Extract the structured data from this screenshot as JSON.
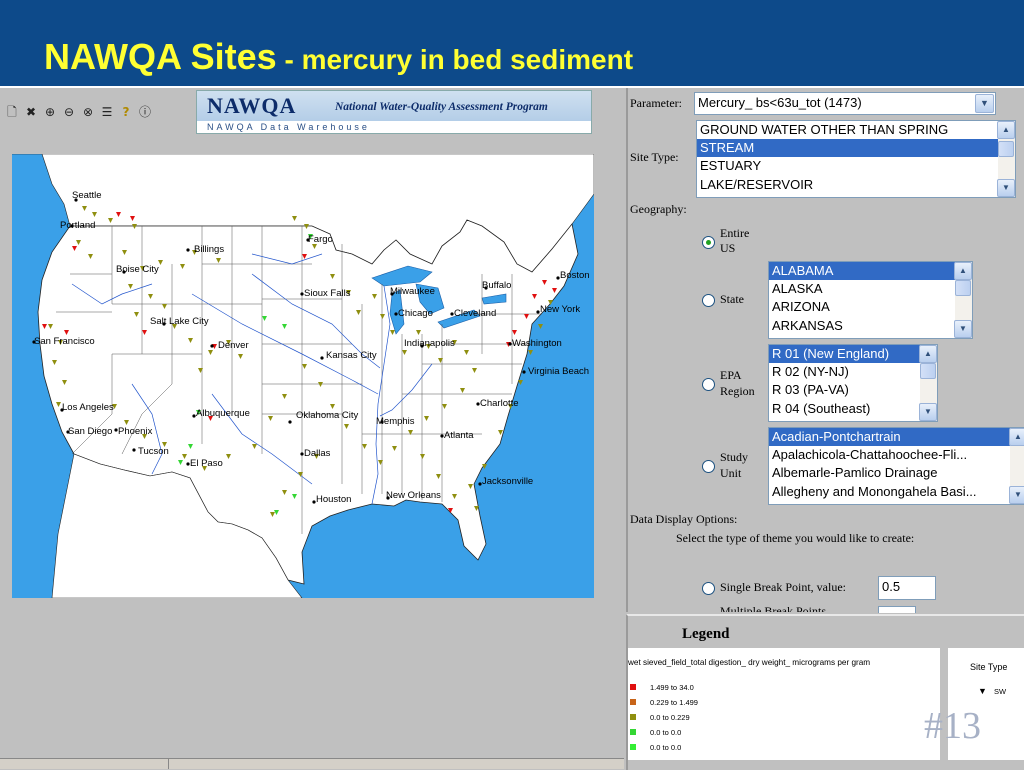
{
  "title": {
    "main": "NAWQA Sites",
    "sub": " - mercury in bed sediment"
  },
  "toolbar_icons": [
    "new-document-icon",
    "pan-icon",
    "zoom-in-icon",
    "zoom-out-icon",
    "zoom-full-icon",
    "layers-icon",
    "help-icon",
    "identify-icon"
  ],
  "banner": {
    "logo": "NAWQA",
    "tagline": "National Water-Quality Assessment Program",
    "subtitle": "NAWQA Data Warehouse"
  },
  "map": {
    "cities": [
      "Seattle",
      "Portland",
      "Billings",
      "Fargo",
      "Boise City",
      "Salt Lake City",
      "Sioux Falls",
      "Milwaukee",
      "Chicago",
      "Cleveland",
      "Buffalo",
      "Boston",
      "New York",
      "Washington",
      "Virginia Beach",
      "San Francisco",
      "Denver",
      "Indianapolis",
      "Kansas City",
      "Los Angeles",
      "San Diego",
      "Phoenix",
      "Tucson",
      "Albuquerque",
      "Oklahoma City",
      "Memphis",
      "Atlanta",
      "Charlotte",
      "El Paso",
      "Dallas",
      "Houston",
      "New Orleans",
      "Jacksonville"
    ]
  },
  "controls": {
    "parameter_label": "Parameter:",
    "parameter_value": "Mercury_ bs<63u_tot (1473)",
    "site_type_label": "Site Type:",
    "site_type_options": [
      "GROUND WATER OTHER THAN SPRING",
      "STREAM",
      "ESTUARY",
      "LAKE/RESERVOIR"
    ],
    "site_type_selected": 1,
    "geography_label": "Geography:",
    "entire_us_label_1": "Entire",
    "entire_us_label_2": "US",
    "state_label": "State",
    "state_options": [
      "ALABAMA",
      "ALASKA",
      "ARIZONA",
      "ARKANSAS"
    ],
    "epa_label_1": "EPA",
    "epa_label_2": "Region",
    "epa_options": [
      "R 01 (New England)",
      "R 02 (NY-NJ)",
      "R 03 (PA-VA)",
      "R 04 (Southeast)"
    ],
    "study_label_1": "Study",
    "study_label_2": "Unit",
    "study_options": [
      "Acadian-Pontchartrain",
      "Apalachicola-Chattahoochee-Fli...",
      "Albemarle-Pamlico Drainage",
      "Allegheny and Monongahela Basi..."
    ],
    "display_options_label": "Data Display Options:",
    "theme_prompt": "Select the type of theme you would like to create:",
    "single_break_label": "Single Break Point, value:",
    "single_break_value": "0.5",
    "multiple_break_label": "Multiple Break Points"
  },
  "legend": {
    "title": "Legend",
    "header": "wet sieved_field_total digestion_ dry weight_ micrograms per gram",
    "rows": [
      {
        "label": "1.499 to 34.0",
        "color": "#e01010"
      },
      {
        "label": "0.229 to 1.499",
        "color": "#c86418"
      },
      {
        "label": "0.0 to 0.229",
        "color": "#8f8f10"
      },
      {
        "label": "0.0 to 0.0",
        "color": "#34d634"
      },
      {
        "label": "0.0 to 0.0",
        "color": "#34ee34"
      }
    ],
    "site_type_header": "Site Type",
    "site_type_symbol": "▼",
    "site_type_code": "SW"
  },
  "slide_number": "#13",
  "colors": {
    "header_bg": "#0d4a8a",
    "title": "#ffff33",
    "map_water": "#3aa0e8",
    "land": "#ffffff",
    "selection": "#316ac5"
  }
}
